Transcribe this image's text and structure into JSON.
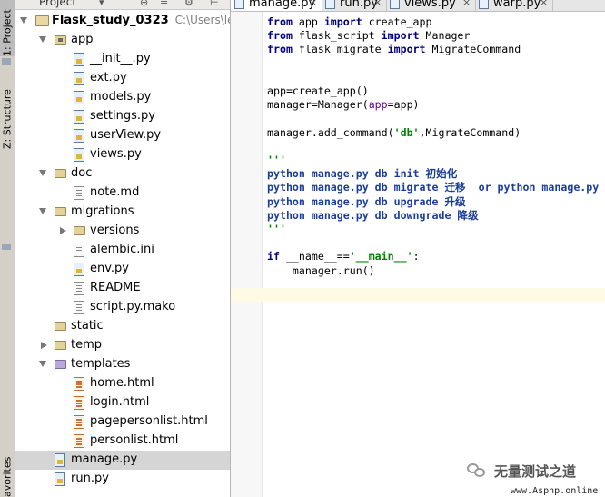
{
  "toolstrip": {
    "project_tab": "1: Project",
    "structure_tab": "Z: Structure",
    "favorites_tab": "avorites"
  },
  "project_panel": {
    "header_label": "Project",
    "tree": [
      {
        "label": "Flask_study_0323",
        "extra": "C:\\Users\\lenov",
        "kind": "project",
        "depth": 0,
        "expanded": true
      },
      {
        "label": "app",
        "kind": "package",
        "depth": 1,
        "expanded": true
      },
      {
        "label": "__init__.py",
        "kind": "py",
        "depth": 2
      },
      {
        "label": "ext.py",
        "kind": "py",
        "depth": 2
      },
      {
        "label": "models.py",
        "kind": "py",
        "depth": 2
      },
      {
        "label": "settings.py",
        "kind": "py",
        "depth": 2
      },
      {
        "label": "userView.py",
        "kind": "py",
        "depth": 2
      },
      {
        "label": "views.py",
        "kind": "py",
        "depth": 2
      },
      {
        "label": "doc",
        "kind": "folder",
        "depth": 1,
        "expanded": true
      },
      {
        "label": "note.md",
        "kind": "md",
        "depth": 2
      },
      {
        "label": "migrations",
        "kind": "folder",
        "depth": 1,
        "expanded": true
      },
      {
        "label": "versions",
        "kind": "folder",
        "depth": 2,
        "expanded": false
      },
      {
        "label": "alembic.ini",
        "kind": "ini",
        "depth": 2
      },
      {
        "label": "env.py",
        "kind": "py",
        "depth": 2
      },
      {
        "label": "README",
        "kind": "txt",
        "depth": 2
      },
      {
        "label": "script.py.mako",
        "kind": "txt",
        "depth": 2
      },
      {
        "label": "static",
        "kind": "folder",
        "depth": 1
      },
      {
        "label": "temp",
        "kind": "folder",
        "depth": 1,
        "expanded": false
      },
      {
        "label": "templates",
        "kind": "templates",
        "depth": 1,
        "expanded": true
      },
      {
        "label": "home.html",
        "kind": "html",
        "depth": 2
      },
      {
        "label": "login.html",
        "kind": "html",
        "depth": 2
      },
      {
        "label": "pagepersonlist.html",
        "kind": "html",
        "depth": 2
      },
      {
        "label": "personlist.html",
        "kind": "html",
        "depth": 2
      },
      {
        "label": "manage.py",
        "kind": "py",
        "depth": 1,
        "selected": true
      },
      {
        "label": "run.py",
        "kind": "py",
        "depth": 1
      }
    ]
  },
  "editor": {
    "tabs": [
      {
        "label": "manage.py",
        "active": true
      },
      {
        "label": "run.py"
      },
      {
        "label": "views.py"
      },
      {
        "label": "warp.py"
      }
    ],
    "code_lines": [
      [
        [
          "kw",
          "from"
        ],
        [
          "n",
          " app "
        ],
        [
          "kw",
          "import"
        ],
        [
          "n",
          " create_app"
        ]
      ],
      [
        [
          "kw",
          "from"
        ],
        [
          "n",
          " flask_script "
        ],
        [
          "kw",
          "import"
        ],
        [
          "n",
          " Manager"
        ]
      ],
      [
        [
          "kw",
          "from"
        ],
        [
          "n",
          " flask_migrate "
        ],
        [
          "kw",
          "import"
        ],
        [
          "n",
          " MigrateCommand"
        ]
      ],
      [],
      [],
      [
        [
          "n",
          "app=create_app()"
        ]
      ],
      [
        [
          "n",
          "manager=Manager("
        ],
        [
          "par",
          "app"
        ],
        [
          "n",
          "=app)"
        ]
      ],
      [],
      [
        [
          "n",
          "manager.add_command("
        ],
        [
          "str",
          "'db'"
        ],
        [
          "n",
          ",MigrateCommand)"
        ]
      ],
      [],
      [
        [
          "docq",
          "'''"
        ]
      ],
      [
        [
          "doc",
          "python manage.py db init "
        ],
        [
          "zh",
          "初始化"
        ]
      ],
      [
        [
          "doc",
          "python manage.py db migrate "
        ],
        [
          "zh",
          "迁移"
        ],
        [
          "doc",
          "  or python manage.py"
        ]
      ],
      [
        [
          "doc",
          "python manage.py db upgrade "
        ],
        [
          "zh",
          "升级"
        ]
      ],
      [
        [
          "doc",
          "python manage.py db downgrade "
        ],
        [
          "zh",
          "降级"
        ]
      ],
      [
        [
          "docq",
          "'''"
        ]
      ],
      [],
      [
        [
          "kw",
          "if"
        ],
        [
          "n",
          " __name__=="
        ],
        [
          "str",
          "'__main__'"
        ],
        [
          "n",
          ":"
        ]
      ],
      [
        [
          "n",
          "    manager.run()"
        ]
      ]
    ]
  },
  "watermark": {
    "text": "无量测试之道",
    "site": "www.Asphp.online"
  },
  "colors": {
    "keyword": "#000080",
    "string": "#008000",
    "docstring": "#1a3c9b",
    "selection": "#d5d5d5",
    "current_line": "#fffae3"
  }
}
